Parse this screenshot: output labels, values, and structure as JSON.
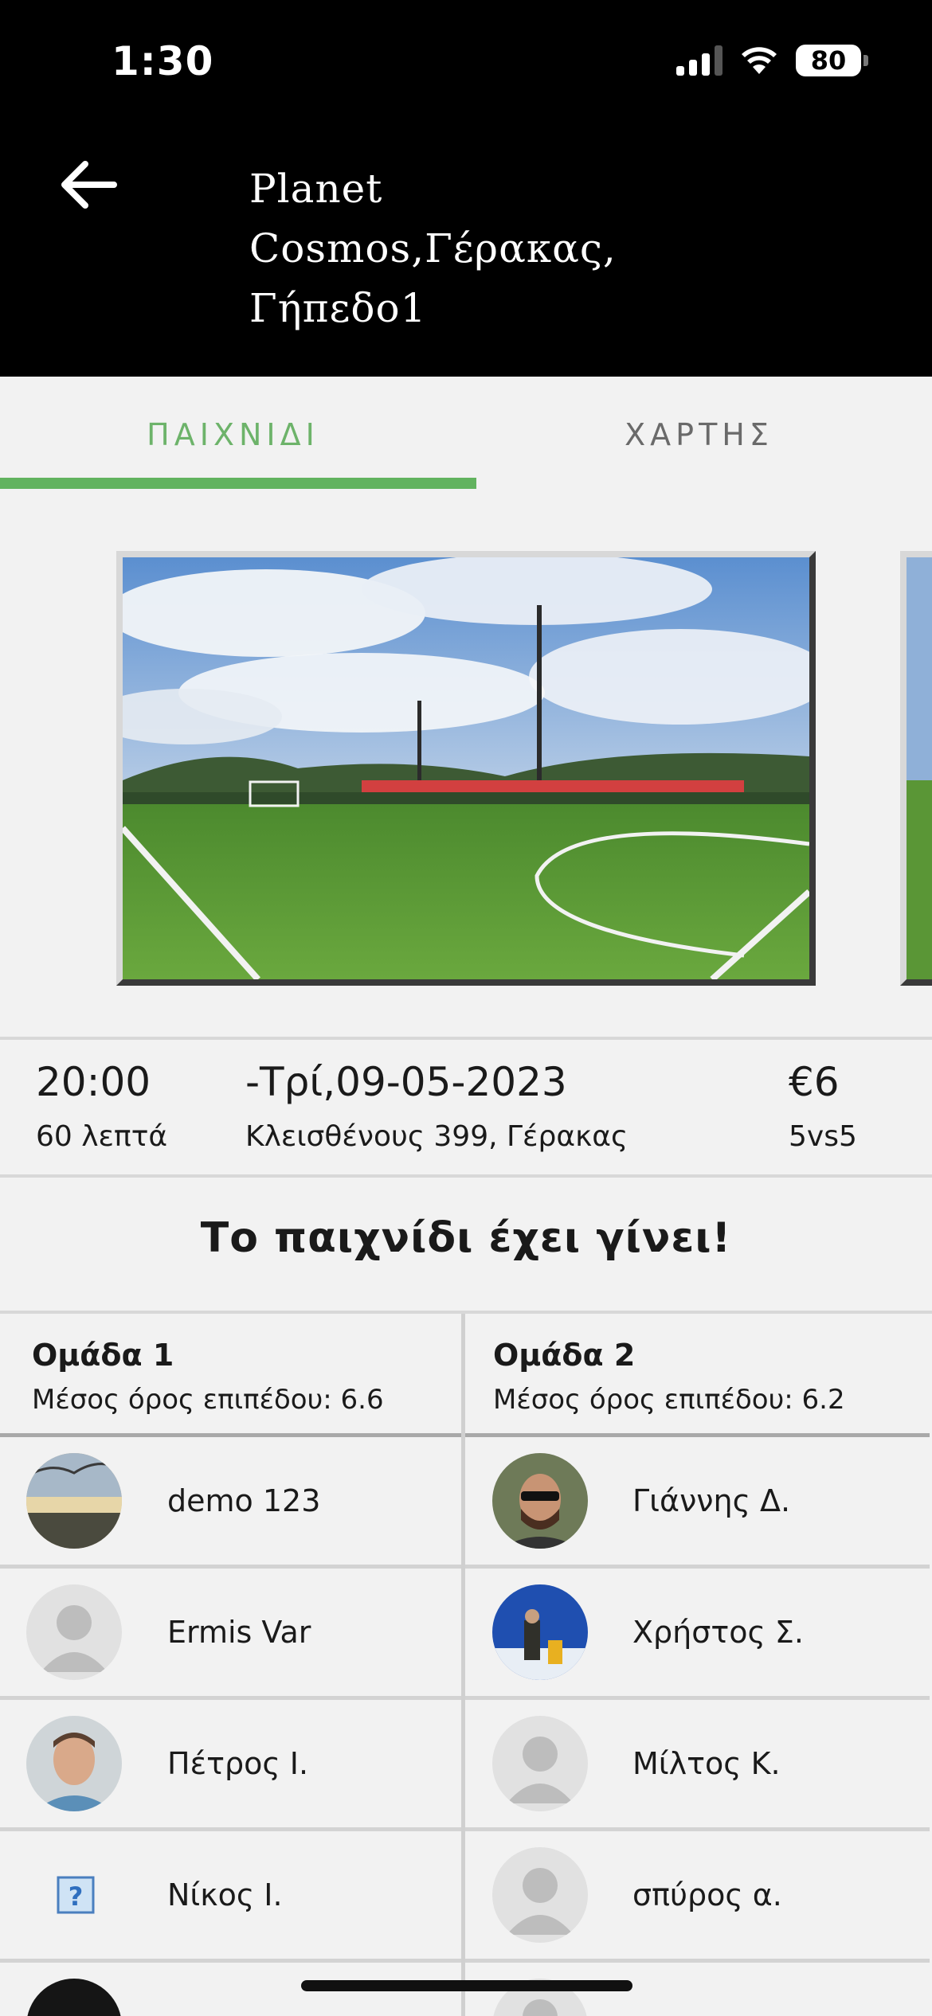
{
  "status_bar": {
    "time": "1:30",
    "battery": "80"
  },
  "header": {
    "title": "Planet Cosmos,Γέρακας, Γήπεδο1"
  },
  "tabs": [
    {
      "label": "ΠΑΙΧΝΙΔΙ",
      "active": true
    },
    {
      "label": "ΧΑΡΤΗΣ",
      "active": false
    }
  ],
  "game": {
    "time": "20:00",
    "duration": "60 λεπτά",
    "date": "-Τρί,09-05-2023",
    "address": "Κλεισθένους 399, Γέρακας",
    "price": "€6",
    "format": "5vs5",
    "status": "Το παιχνίδι έχει γίνει!"
  },
  "teams": [
    {
      "name": "Ομάδα 1",
      "average": "Μέσος όρος επιπέδου: 6.6",
      "players": [
        {
          "name": "demo 123",
          "avatar": "photo-sunset"
        },
        {
          "name": "Ermis Var",
          "avatar": "default-user"
        },
        {
          "name": "Πέτρος Ι.",
          "avatar": "photo-man"
        },
        {
          "name": "Νίκος Ι.",
          "avatar": "broken-image"
        }
      ]
    },
    {
      "name": "Ομάδα 2",
      "average": "Μέσος όρος επιπέδου: 6.2",
      "players": [
        {
          "name": "Γιάννης Δ.",
          "avatar": "photo-bearded"
        },
        {
          "name": "Χρήστος Σ.",
          "avatar": "photo-snow"
        },
        {
          "name": "Μίλτος Κ.",
          "avatar": "default-user"
        },
        {
          "name": "σπύρος α.",
          "avatar": "default-user"
        }
      ]
    }
  ],
  "colors": {
    "accent": "#62b35f",
    "header_bg": "#000000",
    "page_bg": "#f2f2f2"
  }
}
